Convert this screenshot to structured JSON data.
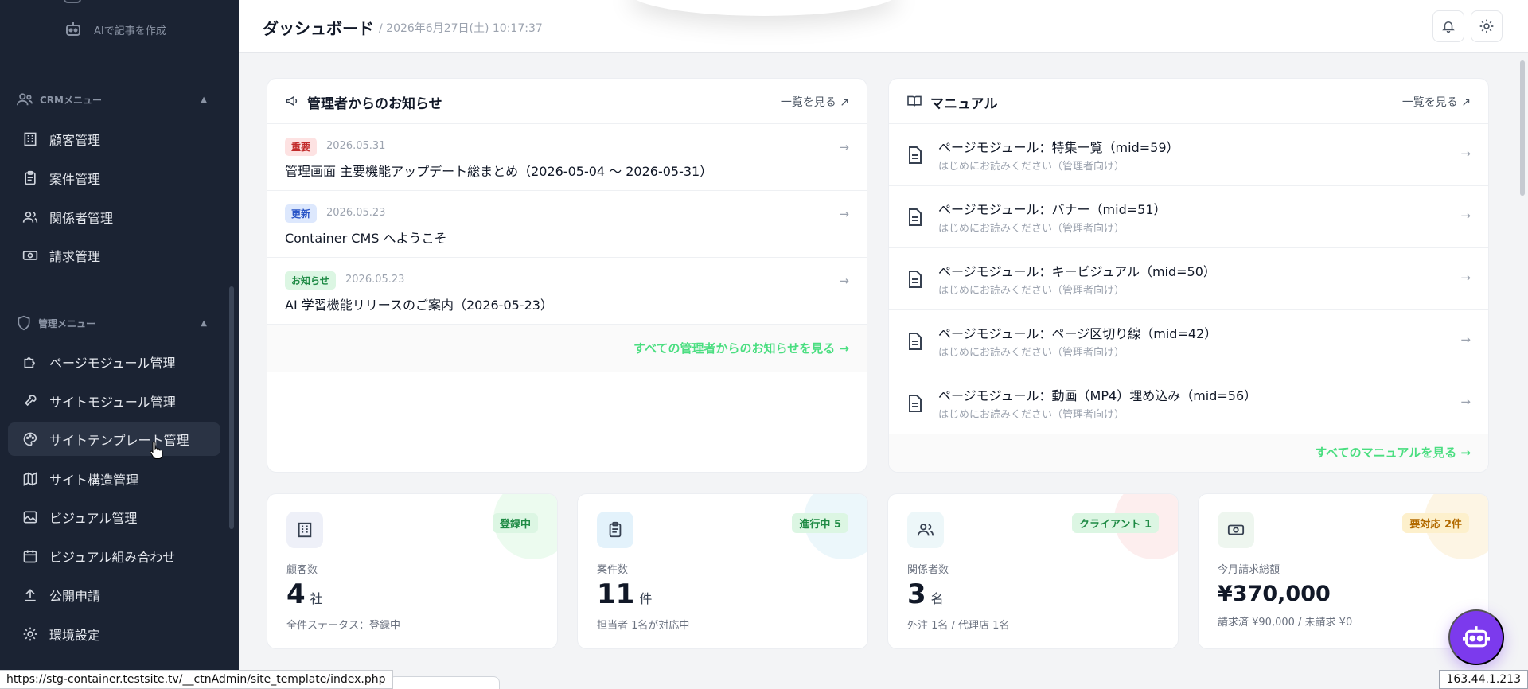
{
  "sidebar": {
    "ai_article": "AIで記事を作成",
    "crm_section": "CRMメニュー",
    "crm_items": [
      "顧客管理",
      "案件管理",
      "関係者管理",
      "請求管理"
    ],
    "admin_section": "管理メニュー",
    "admin_items": [
      "ページモジュール管理",
      "サイトモジュール管理",
      "サイトテンプレート管理",
      "サイト構造管理",
      "ビジュアル管理",
      "ビジュアル組み合わせ",
      "公開申請",
      "環境設定"
    ],
    "hovered_item": "サイトテンプレート管理"
  },
  "header": {
    "title": "ダッシュボード",
    "subtitle": "/ 2026年6月27日(土) 10:17:37"
  },
  "announcements": {
    "title": "管理者からのお知らせ",
    "view_all": "一覧を見る",
    "items": [
      {
        "badge": "重要",
        "date": "2026.05.31",
        "title": "管理画面 主要機能アップデート総まとめ（2026-05-04 〜 2026-05-31）"
      },
      {
        "badge": "更新",
        "date": "2026.05.23",
        "title": "Container CMS へようこそ"
      },
      {
        "badge": "お知らせ",
        "date": "2026.05.23",
        "title": "AI 学習機能リリースのご案内（2026-05-23）"
      }
    ],
    "footer_link": "すべての管理者からのお知らせを見る →"
  },
  "manual": {
    "title": "マニュアル",
    "view_all": "一覧を見る",
    "items": [
      {
        "title": "ページモジュール：特集一覧（mid=59）",
        "sub": "はじめにお読みください（管理者向け）"
      },
      {
        "title": "ページモジュール：バナー（mid=51）",
        "sub": "はじめにお読みください（管理者向け）"
      },
      {
        "title": "ページモジュール：キービジュアル（mid=50）",
        "sub": "はじめにお読みください（管理者向け）"
      },
      {
        "title": "ページモジュール：ページ区切り線（mid=42）",
        "sub": "はじめにお読みください（管理者向け）"
      },
      {
        "title": "ページモジュール：動画（MP4）埋め込み（mid=56）",
        "sub": "はじめにお読みください（管理者向け）"
      }
    ],
    "footer_link": "すべてのマニュアルを見る →"
  },
  "stats": [
    {
      "pill": "登録中",
      "label": "顧客数",
      "value": "4",
      "unit": "社",
      "note": "全件ステータス：登録中"
    },
    {
      "pill": "進行中 5",
      "label": "案件数",
      "value": "11",
      "unit": "件",
      "note": "担当者 1名が対応中"
    },
    {
      "pill": "クライアント 1",
      "label": "関係者数",
      "value": "3",
      "unit": "名",
      "note": "外注 1名 / 代理店 1名"
    },
    {
      "pill": "要対応 2件",
      "label": "今月請求総額",
      "value": "¥370,000",
      "unit": "",
      "note": "請求済 ¥90,000 / 未請求 ¥0"
    }
  ],
  "status_url": "https://stg-container.testsite.tv/__ctnAdmin/site_template/index.php",
  "ip": "163.44.1.213",
  "colors": {
    "sidebar_bg": "#1b2333",
    "accent_green": "#4ade80",
    "fab": "#7c3aed"
  }
}
